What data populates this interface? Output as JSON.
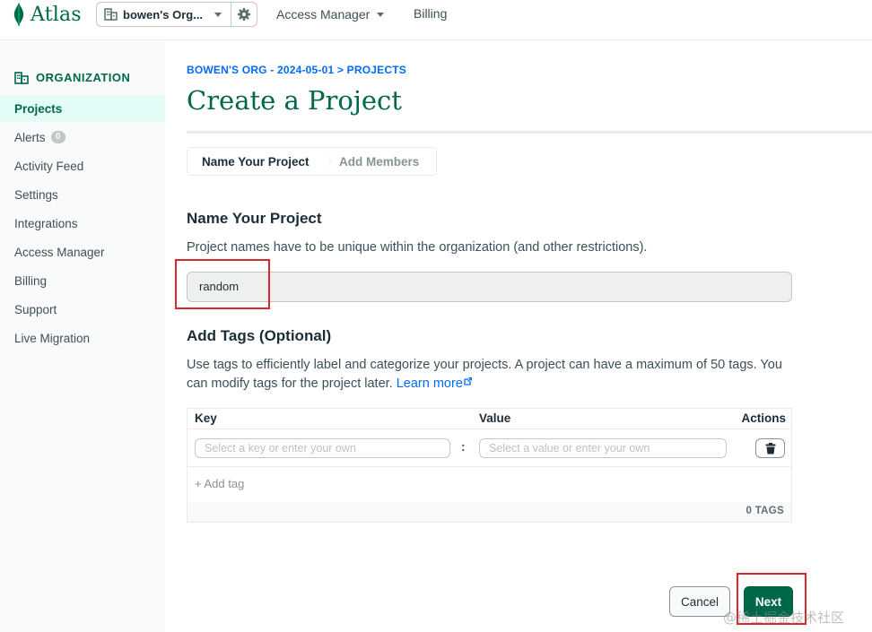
{
  "topbar": {
    "logo_text": "Atlas",
    "org_name": "bowen's Org...",
    "access_manager": "Access Manager",
    "billing": "Billing"
  },
  "sidebar": {
    "header": "ORGANIZATION",
    "items": [
      {
        "label": "Projects"
      },
      {
        "label": "Alerts",
        "badge": "0"
      },
      {
        "label": "Activity Feed"
      },
      {
        "label": "Settings"
      },
      {
        "label": "Integrations"
      },
      {
        "label": "Access Manager"
      },
      {
        "label": "Billing"
      },
      {
        "label": "Support"
      },
      {
        "label": "Live Migration"
      }
    ]
  },
  "main": {
    "breadcrumb": "BOWEN'S ORG - 2024-05-01 > PROJECTS",
    "title": "Create a Project",
    "steps": [
      "Name Your Project",
      "Add Members"
    ],
    "name_section": {
      "title": "Name Your Project",
      "description": "Project names have to be unique within the organization (and other restrictions).",
      "value": "random"
    },
    "tags_section": {
      "title": "Add Tags (Optional)",
      "description": "Use tags to efficiently label and categorize your projects. A project can have a maximum of 50 tags. You can modify tags for the project later.",
      "learn_more": "Learn more",
      "headers": {
        "key": "Key",
        "value": "Value",
        "actions": "Actions"
      },
      "key_placeholder": "Select a key or enter your own",
      "value_placeholder": "Select a value or enter your own",
      "separator": ":",
      "add_tag": "+ Add tag",
      "count": "0 TAGS"
    },
    "buttons": {
      "cancel": "Cancel",
      "next": "Next"
    }
  },
  "watermark": "@稀土掘金技术社区",
  "colors": {
    "brand_green": "#00684a",
    "link_blue": "#016bf8",
    "highlight_red": "#d9262f"
  }
}
